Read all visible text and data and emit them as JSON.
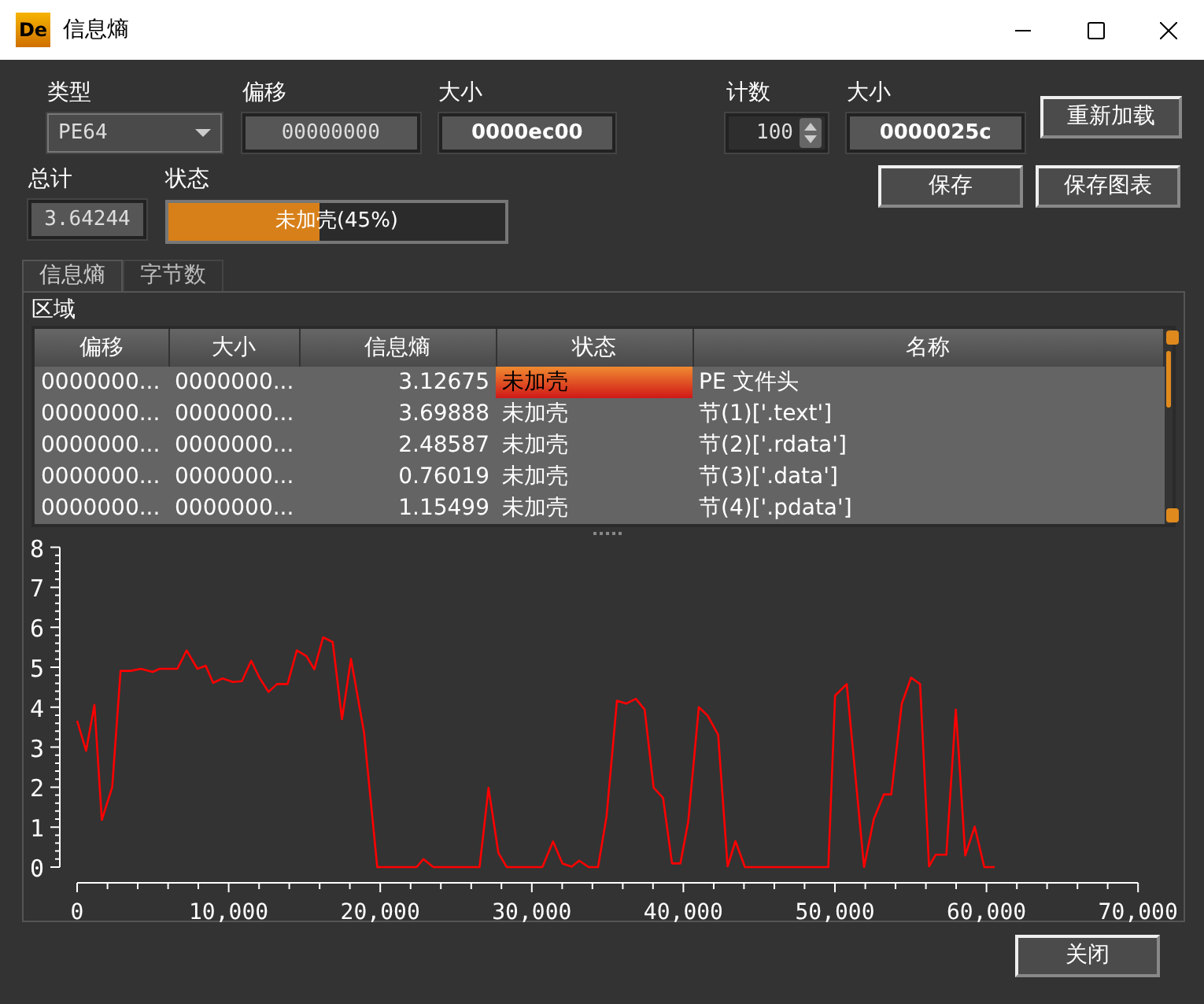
{
  "window": {
    "app_icon": "De",
    "title": "信息熵"
  },
  "fields": [
    {
      "kind": "combo",
      "label": "类型",
      "value": "PE64"
    },
    {
      "kind": "text",
      "label": "偏移",
      "value": "00000000"
    },
    {
      "kind": "bold",
      "label": "大小",
      "value": "0000ec00"
    },
    {
      "kind": "spin",
      "label": "计数",
      "value": "100"
    },
    {
      "kind": "bold",
      "label": "大小",
      "value": "0000025c"
    }
  ],
  "reload_button": "重新加载",
  "total": {
    "label": "总计",
    "value": "3.64244"
  },
  "status": {
    "label": "状态",
    "text": "未加壳(45%)",
    "level": 0.45
  },
  "save_buttons": [
    "保存",
    "保存图表"
  ],
  "tabs": [
    {
      "label": "信息熵",
      "selected": true
    },
    {
      "label": "字节数",
      "selected": false
    }
  ],
  "region_label": "区域",
  "table": {
    "columns": [
      "偏移",
      "大小",
      "信息熵",
      "状态",
      "名称"
    ],
    "rows": [
      {
        "cells": [
          "0000000...",
          "0000000...",
          "3.12675",
          "未加壳",
          "PE 文件头"
        ],
        "selected": true
      },
      {
        "cells": [
          "0000000...",
          "0000000...",
          "3.69888",
          "未加壳",
          "节(1)['.text']"
        ],
        "selected": false
      },
      {
        "cells": [
          "0000000...",
          "0000000...",
          "2.48587",
          "未加壳",
          "节(2)['.rdata']"
        ],
        "selected": false
      },
      {
        "cells": [
          "0000000...",
          "0000000...",
          "0.76019",
          "未加壳",
          "节(3)['.data']"
        ],
        "selected": false
      },
      {
        "cells": [
          "0000000...",
          "0000000...",
          "1.15499",
          "未加壳",
          "节(4)['.pdata']"
        ],
        "selected": false
      }
    ]
  },
  "chart_data": {
    "type": "line",
    "xlim": [
      0,
      70000
    ],
    "ylim": [
      0,
      8
    ],
    "xticks": [
      {
        "value": 0,
        "label": "0"
      },
      {
        "value": 10000,
        "label": "10,000"
      },
      {
        "value": 20000,
        "label": "20,000"
      },
      {
        "value": 30000,
        "label": "30,000"
      },
      {
        "value": 40000,
        "label": "40,000"
      },
      {
        "value": 50000,
        "label": "50,000"
      },
      {
        "value": 60000,
        "label": "60,000"
      },
      {
        "value": 70000,
        "label": "70,000"
      }
    ],
    "yticks": [
      0,
      1,
      2,
      3,
      4,
      5,
      6,
      7,
      8
    ],
    "x": [
      0,
      590,
      1140,
      1630,
      2320,
      2870,
      3530,
      4220,
      4980,
      5430,
      6610,
      7230,
      7930,
      8480,
      8970,
      9590,
      10280,
      10870,
      11490,
      12010,
      12630,
      13190,
      13880,
      14500,
      15130,
      15650,
      16230,
      16860,
      17480,
      18070,
      18930,
      19800,
      22400,
      22850,
      23500,
      26550,
      27140,
      27800,
      28350,
      30700,
      31400,
      32020,
      32640,
      33130,
      33750,
      34370,
      34930,
      35620,
      36240,
      36860,
      37450,
      38040,
      38660,
      39250,
      39800,
      40320,
      41020,
      41600,
      42290,
      42920,
      43440,
      44060,
      49560,
      50010,
      50780,
      51920,
      52570,
      53230,
      53720,
      54410,
      55030,
      55620,
      56210,
      56660,
      57350,
      57970,
      58180,
      58600,
      59220,
      59850,
      60540
    ],
    "series": [
      {
        "color": "#ff0000",
        "values": [
          3.66,
          2.91,
          4.06,
          1.18,
          2.0,
          4.91,
          4.91,
          4.96,
          4.88,
          4.96,
          4.96,
          5.42,
          4.96,
          5.04,
          4.61,
          4.72,
          4.63,
          4.65,
          5.16,
          4.75,
          4.38,
          4.58,
          4.58,
          5.42,
          5.28,
          4.95,
          5.75,
          5.63,
          3.7,
          5.21,
          3.37,
          0,
          0,
          0.2,
          0,
          0,
          1.98,
          0.35,
          0,
          0,
          0.64,
          0.09,
          0.01,
          0.16,
          0,
          0,
          1.27,
          4.16,
          4.09,
          4.21,
          3.94,
          1.99,
          1.73,
          0.09,
          0.09,
          1.14,
          4.0,
          3.79,
          3.31,
          0.02,
          0.65,
          0,
          0,
          4.29,
          4.58,
          0,
          1.2,
          1.82,
          1.82,
          4.09,
          4.74,
          4.58,
          0.02,
          0.31,
          0.31,
          3.94,
          2.78,
          0.29,
          1.01,
          0,
          0
        ]
      }
    ]
  },
  "close_button": "关闭"
}
